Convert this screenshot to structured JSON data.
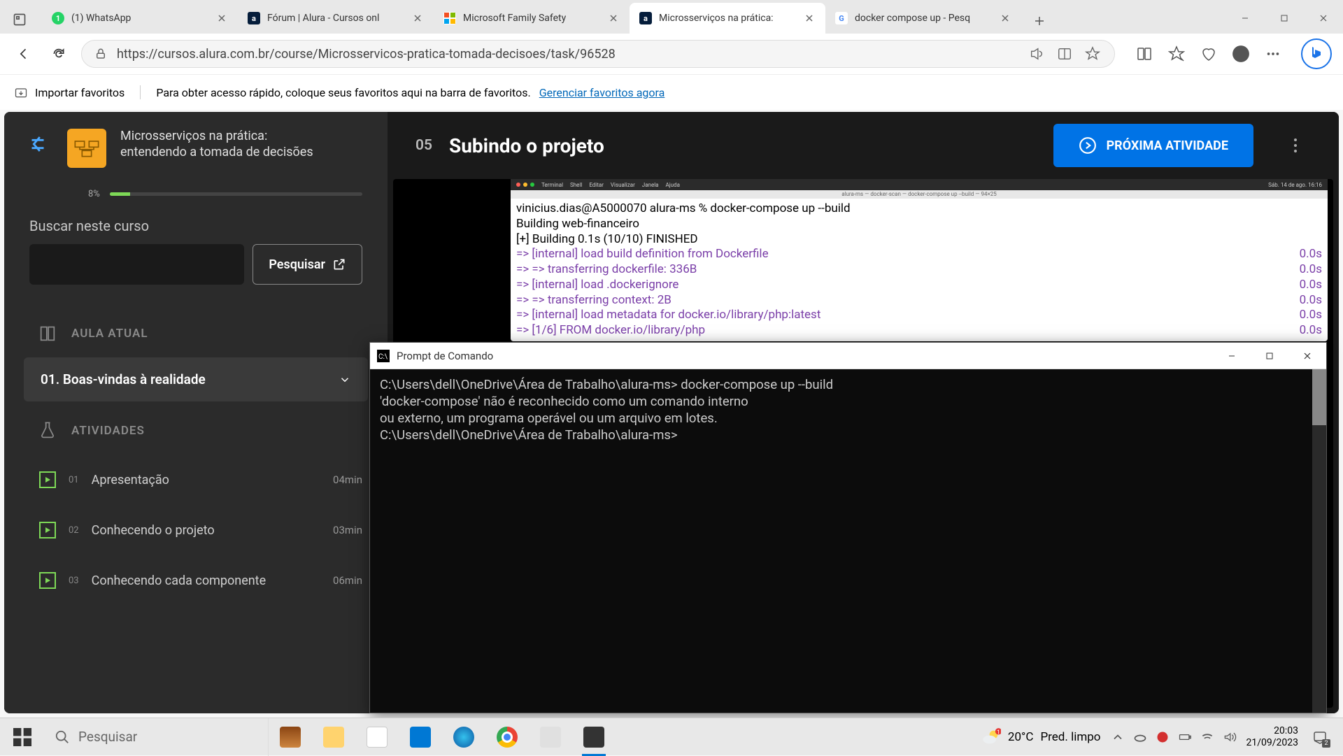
{
  "browser": {
    "tabs": [
      {
        "icon_bg": "#25d366",
        "icon_text": "",
        "title": "(1) WhatsApp"
      },
      {
        "icon_bg": "#051d3b",
        "icon_text": "a",
        "title": "Fórum | Alura - Cursos onl"
      },
      {
        "icon_bg": "#ffffff",
        "icon_text": "",
        "title": "Microsoft Family Safety"
      },
      {
        "icon_bg": "#051d3b",
        "icon_text": "a",
        "title": "Microsserviços na prática:"
      },
      {
        "icon_bg": "#ffffff",
        "icon_text": "G",
        "title": "docker compose up - Pesq"
      }
    ],
    "active_tab_index": 3,
    "url": "https://cursos.alura.com.br/course/Microsservicos-pratica-tomada-decisoes/task/96528",
    "fav_bar": {
      "import": "Importar favoritos",
      "hint": "Para obter acesso rápido, coloque seus favoritos aqui na barra de favoritos.",
      "link": "Gerenciar favoritos agora"
    }
  },
  "sidebar": {
    "course_title": "Microsserviços na prática:",
    "course_subtitle": "entendendo a tomada de decisões",
    "progress_pct": "8%",
    "search_label": "Buscar neste curso",
    "search_btn": "Pesquisar",
    "section_aula": "AULA ATUAL",
    "current_lesson": "01. Boas-vindas à realidade",
    "section_atividades": "ATIVIDADES",
    "activities": [
      {
        "num": "01",
        "title": "Apresentação",
        "dur": "04min"
      },
      {
        "num": "02",
        "title": "Conhecendo o projeto",
        "dur": "03min"
      },
      {
        "num": "03",
        "title": "Conhecendo cada componente",
        "dur": "06min"
      }
    ]
  },
  "content": {
    "lesson_num": "05",
    "lesson_title": "Subindo o projeto",
    "next_btn": "PRÓXIMA ATIVIDADE"
  },
  "mac_terminal": {
    "menubar": [
      "Terminal",
      "Shell",
      "Editar",
      "Visualizar",
      "Janela",
      "Ajuda"
    ],
    "clock": "Sáb. 14 de ago. 16:16",
    "tab_label": "alura-ms — docker-scan — docker-compose up --build — 94×25",
    "prompt_line": "vinicius.dias@A5000070 alura-ms % docker-compose up --build",
    "plain_lines": [
      "Building web-financeiro",
      "[+] Building 0.1s (10/10) FINISHED"
    ],
    "steps": [
      {
        "text": "=> [internal] load build definition from Dockerfile",
        "time": "0.0s"
      },
      {
        "text": "=> => transferring dockerfile: 336B",
        "time": "0.0s"
      },
      {
        "text": "=> [internal] load .dockerignore",
        "time": "0.0s"
      },
      {
        "text": "=> => transferring context: 2B",
        "time": "0.0s"
      },
      {
        "text": "=> [internal] load metadata for docker.io/library/php:latest",
        "time": "0.0s"
      },
      {
        "text": "=> [1/6] FROM docker.io/library/php",
        "time": "0.0s"
      }
    ]
  },
  "cmd": {
    "title": "Prompt de Comando",
    "lines": [
      "C:\\Users\\dell\\OneDrive\\Área de Trabalho\\alura-ms> docker-compose up --build",
      "'docker-compose' não é reconhecido como um comando interno",
      "ou externo, um programa operável ou um arquivo em lotes.",
      "",
      "C:\\Users\\dell\\OneDrive\\Área de Trabalho\\alura-ms>"
    ]
  },
  "taskbar": {
    "search_placeholder": "Pesquisar",
    "weather_temp": "20°C",
    "weather_text": "Pred. limpo",
    "time": "20:03",
    "date": "21/09/2023",
    "notif_count": "2"
  }
}
